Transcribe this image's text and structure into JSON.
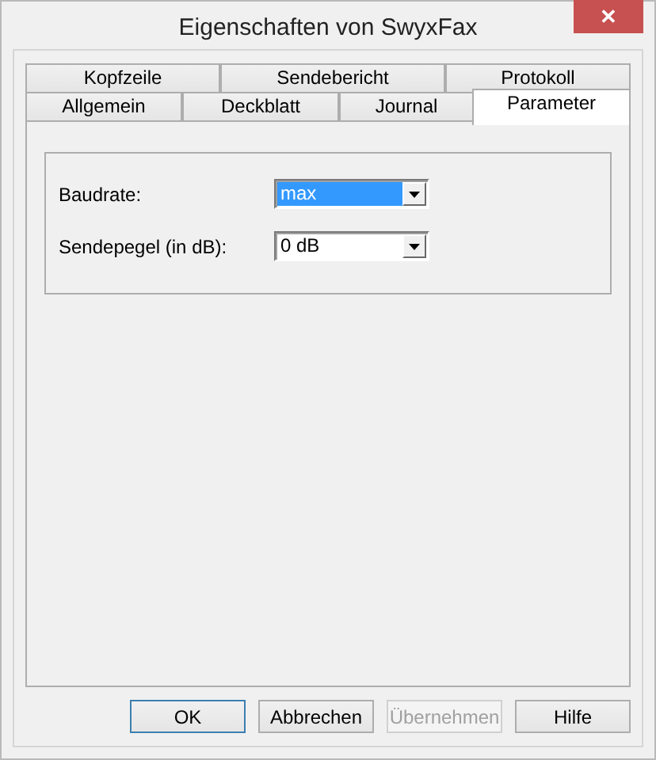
{
  "window": {
    "title": "Eigenschaften von SwyxFax",
    "close": "✕"
  },
  "tab_rows": [
    [
      {
        "label": "Kopfzeile",
        "selected": false
      },
      {
        "label": "Sendebericht",
        "selected": false
      },
      {
        "label": "Protokoll",
        "selected": false
      }
    ],
    [
      {
        "label": "Allgemein",
        "selected": false
      },
      {
        "label": "Deckblatt",
        "selected": false
      },
      {
        "label": "Journal",
        "selected": false
      },
      {
        "label": "Parameter",
        "selected": true
      }
    ]
  ],
  "fields": [
    {
      "label": "Baudrate:",
      "value": "max",
      "focused": true
    },
    {
      "label": "Sendepegel (in dB):",
      "value": "0 dB",
      "focused": false
    }
  ],
  "buttons": [
    {
      "label": "OK",
      "default": true,
      "disabled": false
    },
    {
      "label": "Abbrechen",
      "default": false,
      "disabled": false
    },
    {
      "label": "Übernehmen",
      "default": false,
      "disabled": true
    },
    {
      "label": "Hilfe",
      "default": false,
      "disabled": false
    }
  ]
}
